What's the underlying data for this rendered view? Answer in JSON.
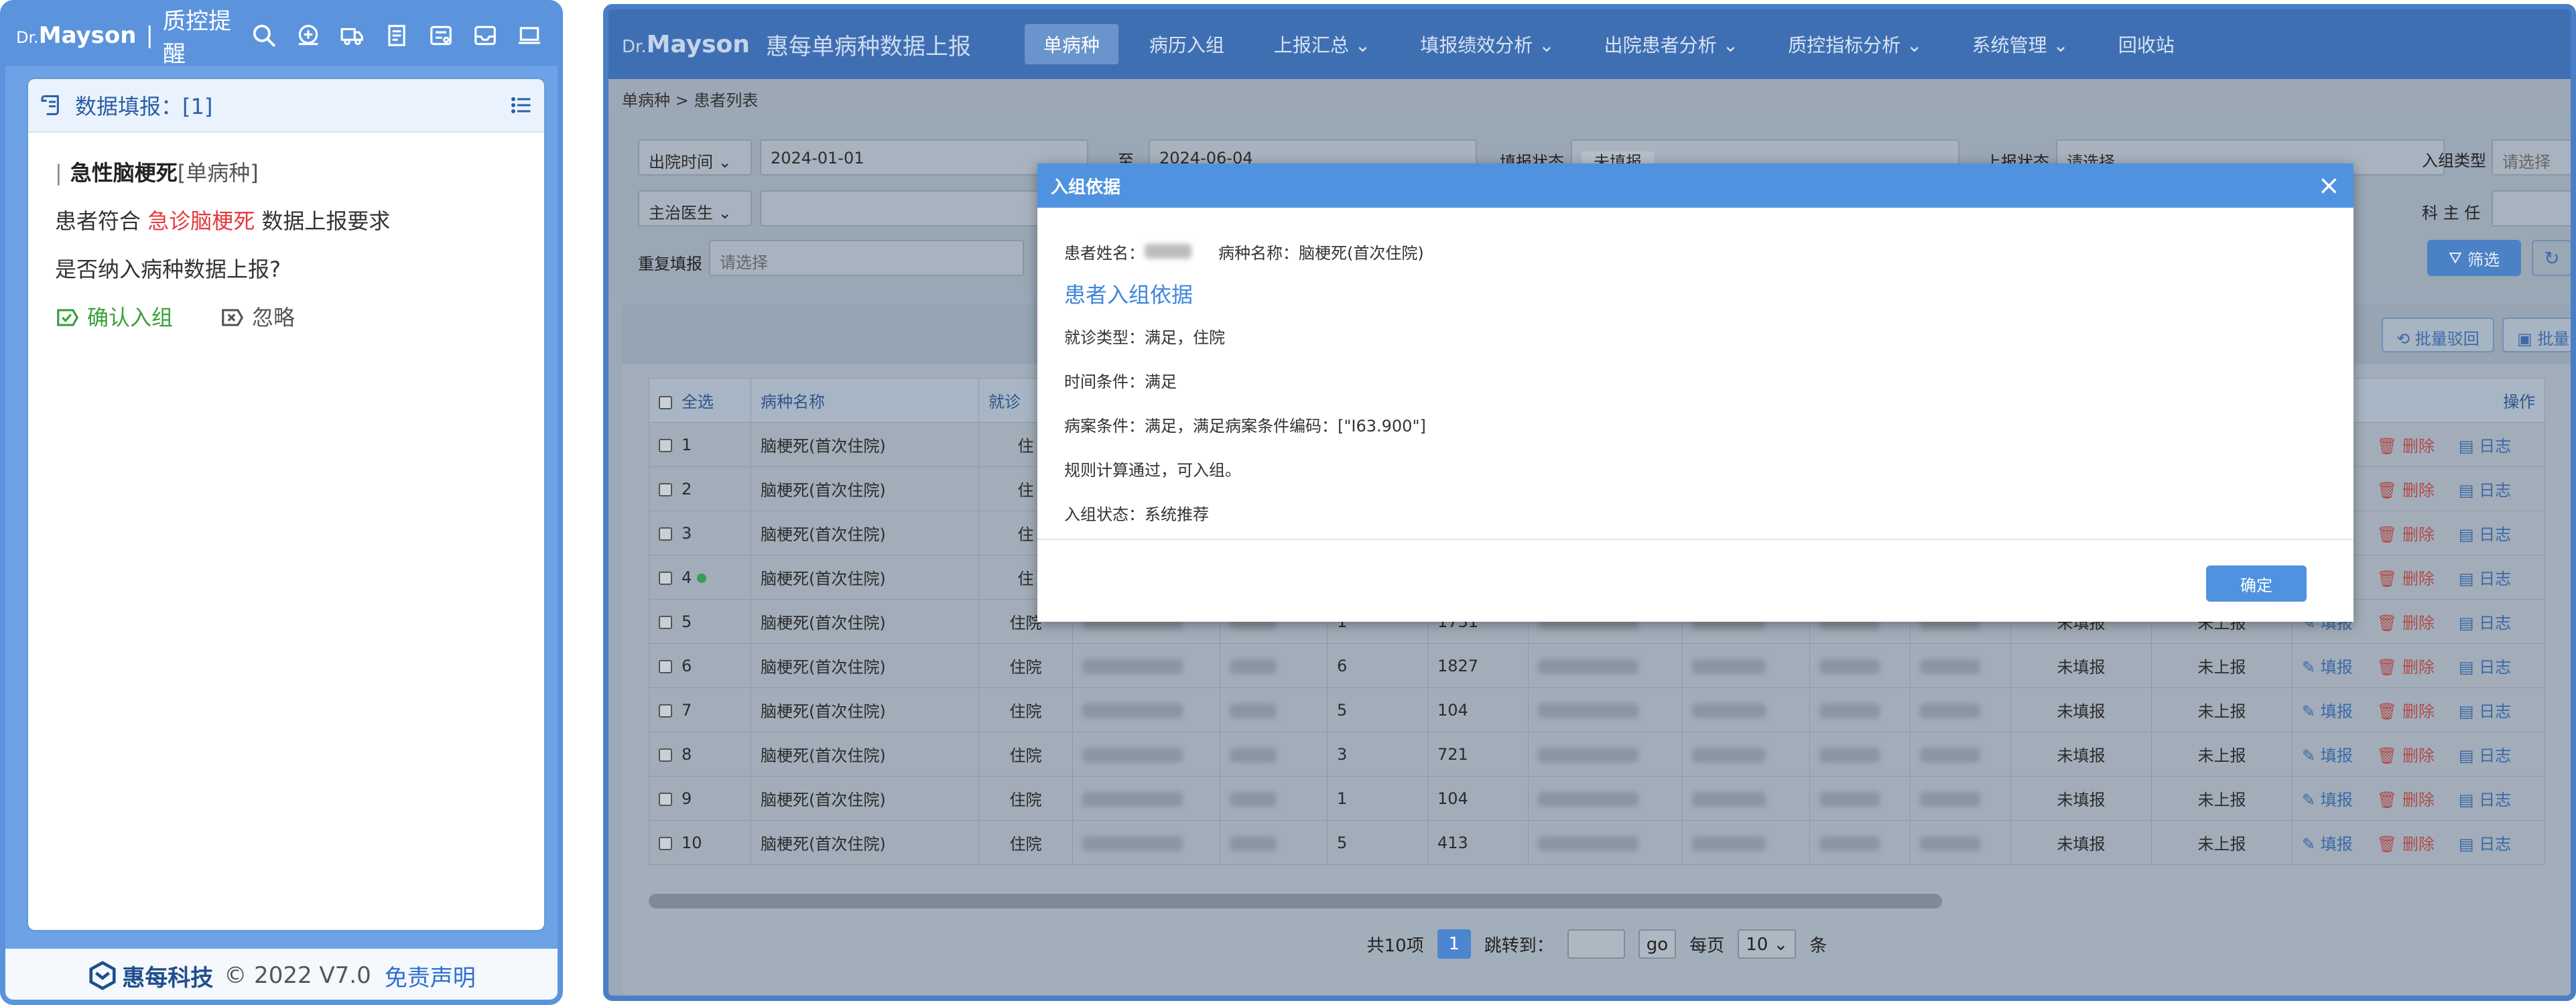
{
  "left_panel": {
    "brand_prefix": "Dr.",
    "brand_name": "Mayson",
    "separator": "|",
    "title": "质控提醒",
    "icons": [
      "search-icon",
      "medical-add-icon",
      "truck-icon",
      "document-icon",
      "reminder-icon",
      "inbox-icon",
      "laptop-icon"
    ],
    "card_title": "数据填报：[1]",
    "disease_name": "急性脑梗死",
    "disease_tag": "[单病种]",
    "line1_prefix": "患者符合",
    "line1_highlight": "急诊脑梗死",
    "line1_suffix": "数据上报要求",
    "line2": "是否纳入病种数据上报?",
    "confirm_label": "确认入组",
    "ignore_label": "忽略",
    "footer_company": "惠每科技",
    "footer_copyright": "© 2022 V7.0",
    "footer_disclaimer": "免责声明",
    "colors": {
      "header": "#5b93dd",
      "highlight": "#e4393c",
      "confirm": "#3aa03a",
      "link": "#2d6fd0"
    }
  },
  "right_window": {
    "brand_prefix": "Dr.",
    "brand_name": "Mayson",
    "app_title": "惠每单病种数据上报",
    "nav": [
      "单病种",
      "病历入组",
      "上报汇总",
      "填报绩效分析",
      "出院患者分析",
      "质控指标分析",
      "系统管理",
      "回收站"
    ],
    "nav_active": "单病种",
    "breadcrumb": "单病种 > 患者列表",
    "filters": {
      "date_type": "出院时间",
      "date_from": "2024-01-01",
      "to_label": "至",
      "date_to": "2024-06-04",
      "fill_status_label": "填报状态",
      "fill_status_value": "未填报",
      "report_status_label": "上报状态",
      "report_status_placeholder": "请选择",
      "group_type_label": "入组类型",
      "group_type_placeholder": "请选择",
      "doctor_type": "主治医生",
      "dept_label": "科 主 任",
      "repeat_label": "重复填报",
      "repeat_placeholder": "请选择",
      "filter_button": "筛选"
    },
    "toolbar": {
      "batch_reject": "批量驳回",
      "batch_approve": "批量审"
    },
    "table": {
      "headers": {
        "select_all": "全选",
        "disease": "病种名称",
        "visit": "就诊",
        "ops": "操作"
      },
      "rows": [
        {
          "no": "1",
          "disease": "脑梗死(首次住院)",
          "visit": "住",
          "count": "",
          "code": "",
          "fill": "",
          "report": ""
        },
        {
          "no": "2",
          "disease": "脑梗死(首次住院)",
          "visit": "住",
          "count": "",
          "code": "",
          "fill": "",
          "report": ""
        },
        {
          "no": "3",
          "disease": "脑梗死(首次住院)",
          "visit": "住",
          "count": "",
          "code": "",
          "fill": "",
          "report": ""
        },
        {
          "no": "4",
          "disease": "脑梗死(首次住院)",
          "visit": "住",
          "count": "",
          "code": "",
          "fill": "",
          "report": ""
        },
        {
          "no": "5",
          "disease": "脑梗死(首次住院)",
          "visit": "住院",
          "count": "1",
          "code": "1731",
          "fill": "未填报",
          "report": "未上报"
        },
        {
          "no": "6",
          "disease": "脑梗死(首次住院)",
          "visit": "住院",
          "count": "6",
          "code": "1827",
          "fill": "未填报",
          "report": "未上报"
        },
        {
          "no": "7",
          "disease": "脑梗死(首次住院)",
          "visit": "住院",
          "count": "5",
          "code": "104",
          "fill": "未填报",
          "report": "未上报"
        },
        {
          "no": "8",
          "disease": "脑梗死(首次住院)",
          "visit": "住院",
          "count": "3",
          "code": "721",
          "fill": "未填报",
          "report": "未上报"
        },
        {
          "no": "9",
          "disease": "脑梗死(首次住院)",
          "visit": "住院",
          "count": "1",
          "code": "104",
          "fill": "未填报",
          "report": "未上报"
        },
        {
          "no": "10",
          "disease": "脑梗死(首次住院)",
          "visit": "住院",
          "count": "5",
          "code": "413",
          "fill": "未填报",
          "report": "未上报"
        }
      ],
      "op_fill": "填报",
      "op_delete": "删除",
      "op_log": "日志"
    },
    "pager": {
      "total": "共10项",
      "current": "1",
      "goto_label": "跳转到：",
      "go": "go",
      "per_page": "每页",
      "size": "10",
      "unit": "条"
    }
  },
  "modal": {
    "title": "入组依据",
    "patient_label": "患者姓名：",
    "disease_label": "病种名称：脑梗死(首次住院)",
    "subtitle": "患者入组依据",
    "line_visit": "就诊类型：满足，住院",
    "line_time": "时间条件：满足",
    "line_case": "病案条件：满足，满足病案条件编码：[\"I63.900\"]",
    "line_rule": "规则计算通过，可入组。",
    "line_status": "入组状态：系统推荐",
    "ok": "确定"
  }
}
